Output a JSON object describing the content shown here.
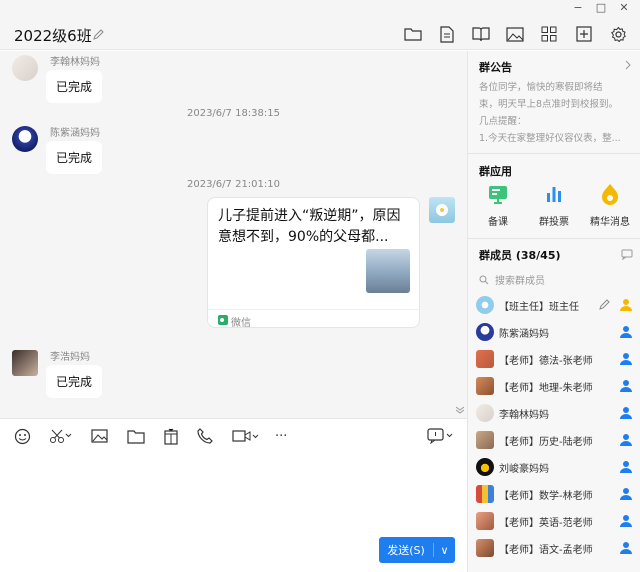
{
  "window": {
    "minimize": "−",
    "maximize": "□",
    "close": "✕"
  },
  "header": {
    "title": "2022级6班"
  },
  "messages": [
    {
      "sender": "李翰林妈妈",
      "text": "已完成"
    },
    {
      "timestamp": "2023/6/7 18:38:15"
    },
    {
      "sender": "陈紫涵妈妈",
      "text": "已完成"
    },
    {
      "timestamp": "2023/6/7 21:01:10"
    },
    {
      "card_title": "儿子提前进入“叛逆期”，原因意想不到，90%的父母都...",
      "card_source": "微信"
    },
    {
      "sender": "李浩妈妈",
      "text": "已完成"
    }
  ],
  "composer": {
    "send_label": "发送(S)",
    "send_caret": "∨",
    "more": "···"
  },
  "sidebar": {
    "notice_title": "群公告",
    "notice_lines": [
      "各位同学，愉快的寒假即将结",
      "束，明天早上8点准时到校报到。",
      "几点提醒：",
      "1.今天在家整理好仪容仪表，整..."
    ],
    "apps_title": "群应用",
    "apps": [
      {
        "label": "备课",
        "icon": "lesson-icon"
      },
      {
        "label": "群投票",
        "icon": "vote-icon"
      },
      {
        "label": "精华消息",
        "icon": "highlight-icon"
      }
    ],
    "members_title": "群成员 (38/45)",
    "search_placeholder": "搜索群成员",
    "members": [
      {
        "name": "【班主任】班主任"
      },
      {
        "name": "陈紫涵妈妈"
      },
      {
        "name": "【老师】德法-张老师"
      },
      {
        "name": "【老师】地理-朱老师"
      },
      {
        "name": "李翰林妈妈"
      },
      {
        "name": "【老师】历史-陆老师"
      },
      {
        "name": "刘峻豪妈妈"
      },
      {
        "name": "【老师】数学-林老师"
      },
      {
        "name": "【老师】英语-范老师"
      },
      {
        "name": "【老师】语文-孟老师"
      }
    ]
  },
  "colors": {
    "accent": "#1e7ef0",
    "member_icon": "#1e7ef0",
    "owner_icon": "#f5b800"
  }
}
